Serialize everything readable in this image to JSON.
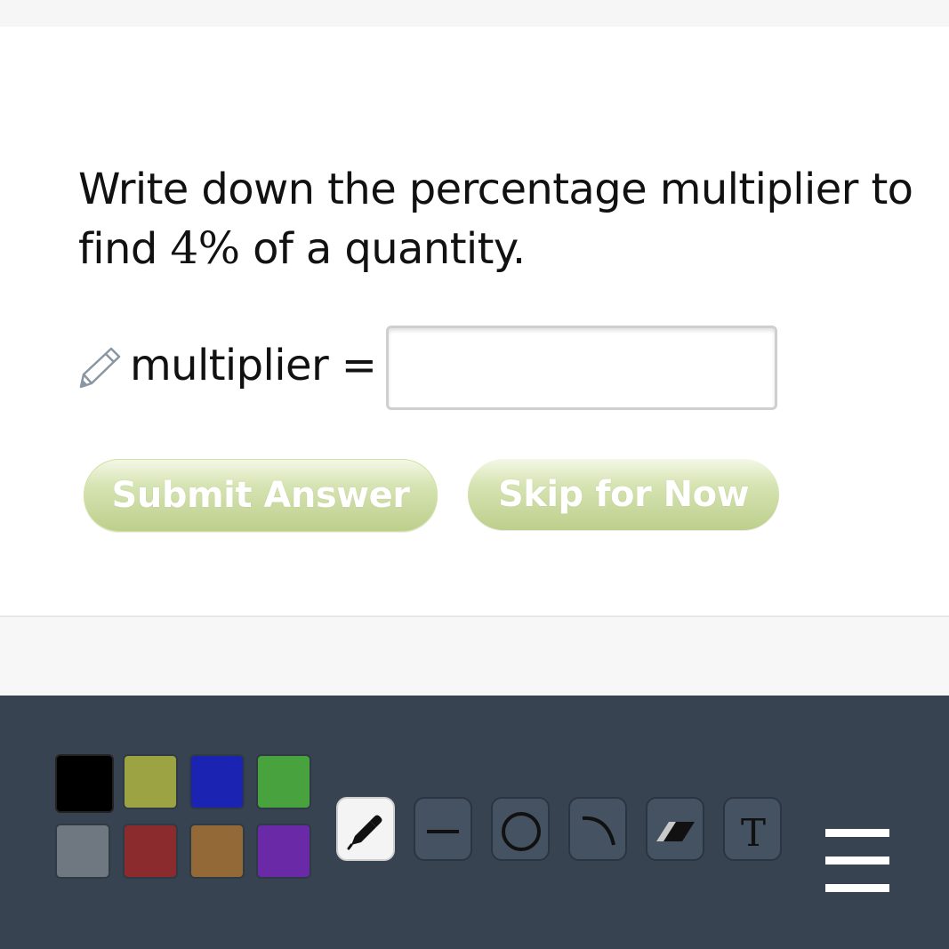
{
  "question": {
    "text_before": "Write down the percentage multiplier to find ",
    "math": "4%",
    "text_after": " of a quantity."
  },
  "answer": {
    "label": "multiplier =",
    "value": "",
    "placeholder": ""
  },
  "buttons": {
    "submit": "Submit Answer",
    "skip": "Skip for Now"
  },
  "drawing_toolbar": {
    "colors": [
      {
        "name": "black",
        "hex": "#000000",
        "selected": true
      },
      {
        "name": "olive",
        "hex": "#9ba342",
        "selected": false
      },
      {
        "name": "blue",
        "hex": "#1b24b2",
        "selected": false
      },
      {
        "name": "green",
        "hex": "#48a33f",
        "selected": false
      },
      {
        "name": "gray",
        "hex": "#6f7780",
        "selected": false
      },
      {
        "name": "red",
        "hex": "#8b2b2e",
        "selected": false
      },
      {
        "name": "brown",
        "hex": "#936a37",
        "selected": false
      },
      {
        "name": "purple",
        "hex": "#6a2aa8",
        "selected": false
      }
    ],
    "tools": [
      {
        "icon": "pen-icon",
        "active": true
      },
      {
        "icon": "line-icon",
        "active": false
      },
      {
        "icon": "circle-icon",
        "active": false
      },
      {
        "icon": "arc-icon",
        "active": false
      },
      {
        "icon": "eraser-icon",
        "active": false
      },
      {
        "icon": "text-icon",
        "active": false
      }
    ],
    "menu_icon": "hamburger-menu-icon"
  }
}
